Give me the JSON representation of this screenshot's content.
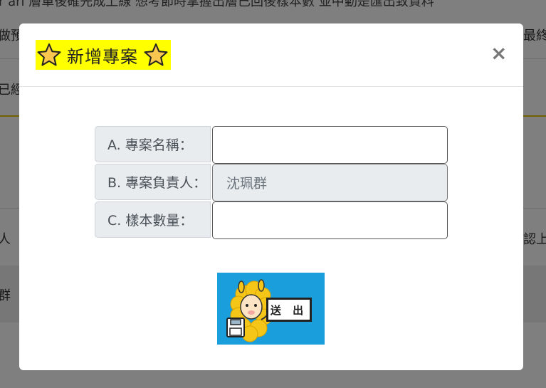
{
  "background": {
    "top_text": "r ari 層單後確先成上線 想考節時掌握出層已回後樣本數 並中勤是匯出致資料",
    "row1_left": "做預",
    "row1_right": "最終",
    "row2_left": "已經",
    "row3_left": "人",
    "row3_right": "認上線",
    "row4_left": "群"
  },
  "modal": {
    "title": "新增專案",
    "close_label": "×",
    "fields": [
      {
        "label": "A. 專案名稱：",
        "value": "",
        "placeholder": ""
      },
      {
        "label": "B. 專案負責人：",
        "value": "沈珮群",
        "placeholder": ""
      },
      {
        "label": "C. 樣本數量：",
        "value": "",
        "placeholder": ""
      }
    ],
    "submit_label": "送 出"
  },
  "colors": {
    "title_highlight": "#ffff00",
    "submit_bg": "#1a9fdc",
    "star_fill": "#f9c74f",
    "input_disabled_bg": "#e9ecef"
  },
  "icons": {
    "title_left": "star-icon",
    "title_right": "star-icon",
    "close": "close-icon",
    "submit_mascot": "alpaca-icon"
  }
}
